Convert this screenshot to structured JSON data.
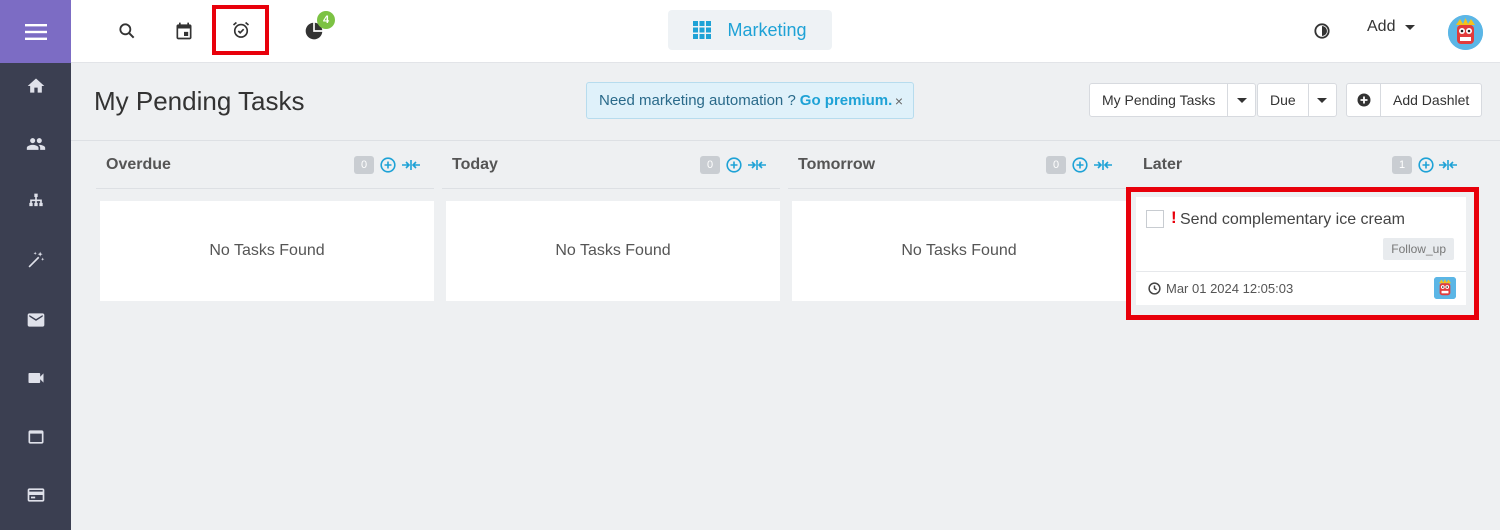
{
  "sidebar": {
    "items": [
      {
        "icon": "home-icon"
      },
      {
        "icon": "users-icon"
      },
      {
        "icon": "org-chart-icon"
      },
      {
        "icon": "magic-wand-icon"
      },
      {
        "icon": "mail-icon"
      },
      {
        "icon": "video-icon"
      },
      {
        "icon": "window-icon"
      },
      {
        "icon": "card-icon"
      }
    ]
  },
  "topbar": {
    "notification_count": "4",
    "module_label": "Marketing",
    "add_label": "Add"
  },
  "page": {
    "title": "My Pending Tasks",
    "promo_text": "Need marketing automation ?",
    "promo_link": "Go premium.",
    "promo_close": "×"
  },
  "toolbar": {
    "view_select": "My Pending Tasks",
    "sort_select": "Due",
    "add_dashlet": "Add Dashlet"
  },
  "columns": [
    {
      "title": "Overdue",
      "count": "0",
      "empty_text": "No Tasks Found"
    },
    {
      "title": "Today",
      "count": "0",
      "empty_text": "No Tasks Found"
    },
    {
      "title": "Tomorrow",
      "count": "0",
      "empty_text": "No Tasks Found"
    },
    {
      "title": "Later",
      "count": "1"
    }
  ],
  "task": {
    "priority_mark": "!",
    "title": "Send complementary ice cream",
    "tag": "Follow_up",
    "due": "Mar 01 2024 12:05:03"
  },
  "colors": {
    "sidebar_bg": "#3b3f51",
    "sidebar_menu_bg": "#7c6cc4",
    "accent": "#1ea2d6",
    "badge": "#7cc243",
    "highlight": "#e8000b"
  }
}
